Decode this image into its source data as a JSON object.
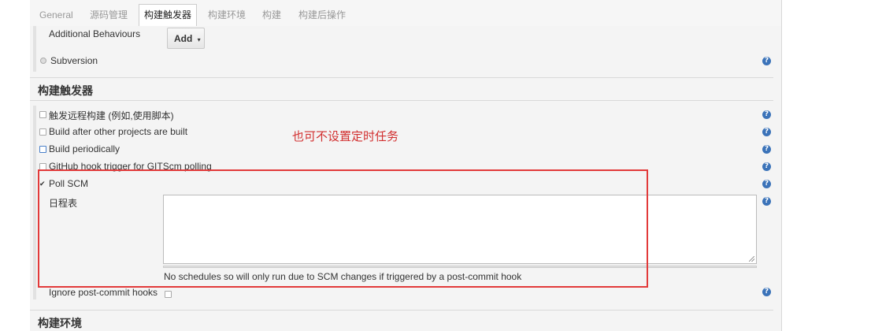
{
  "tabs": [
    {
      "label": "General"
    },
    {
      "label": "源码管理"
    },
    {
      "label": "构建触发器"
    },
    {
      "label": "构建环境"
    },
    {
      "label": "构建"
    },
    {
      "label": "构建后操作"
    }
  ],
  "scm": {
    "additional_behaviours_label": "Additional Behaviours",
    "add_button_label": "Add",
    "add_caret": "▾",
    "subversion_label": "Subversion"
  },
  "triggers": {
    "section_title": "构建触发器",
    "items": [
      {
        "label": "触发远程构建 (例如,使用脚本)"
      },
      {
        "label": "Build after other projects are built"
      },
      {
        "label": "Build periodically"
      },
      {
        "label": "GitHub hook trigger for GITScm polling"
      },
      {
        "label": "Poll SCM",
        "checked": true
      }
    ],
    "schedule_label": "日程表",
    "schedule_value": "",
    "schedule_hint": "No schedules so will only run due to SCM changes if triggered by a post-commit hook",
    "ignore_post_commit_label": "Ignore post-commit hooks"
  },
  "next_section_title": "构建环境",
  "annotation": "也可不设置定时任务",
  "help_glyph": "?",
  "check_glyph": "✔",
  "colors": {
    "annotation": "#d23030",
    "help_icon": "#3b73b9"
  }
}
